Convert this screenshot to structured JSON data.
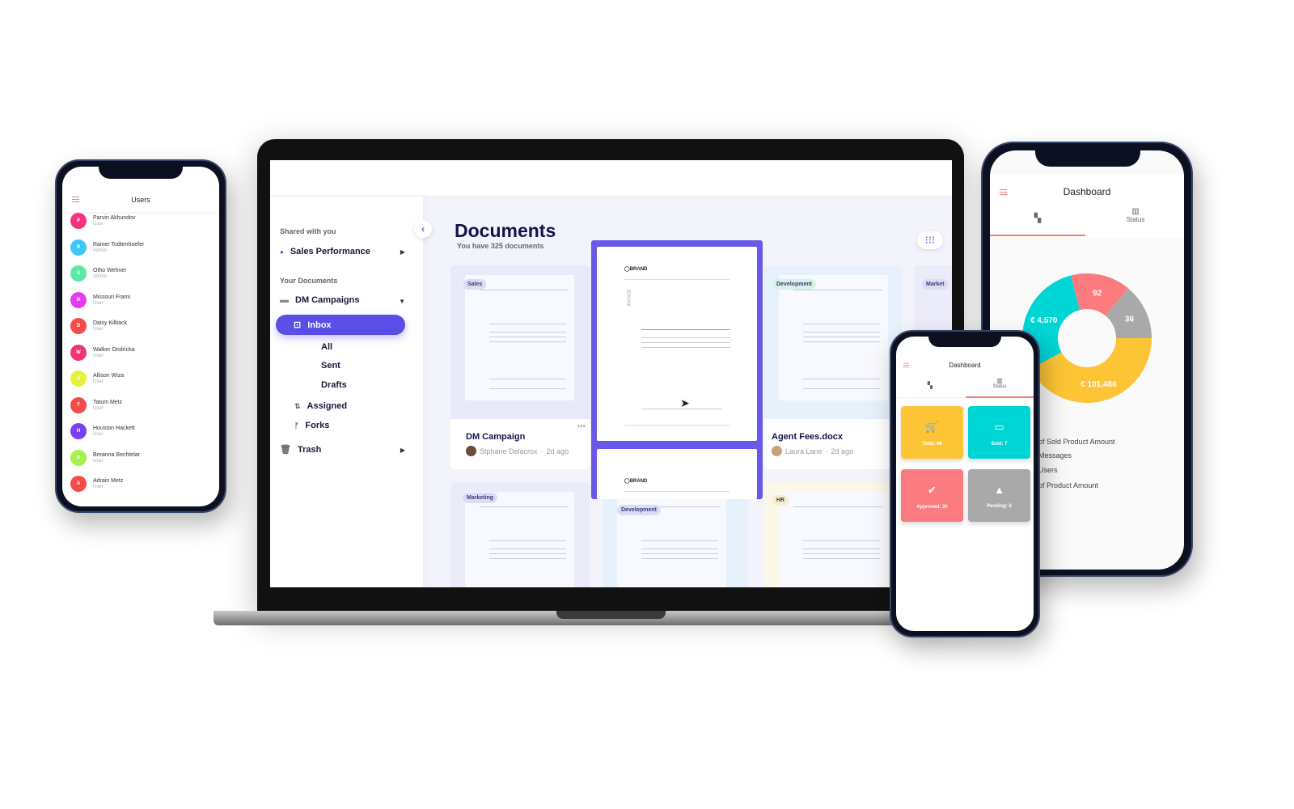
{
  "laptop": {
    "sidebar": {
      "shared_caption": "Shared with you",
      "shared_item": "Sales Performance",
      "your_caption": "Your Documents",
      "folder": "DM Campaigns",
      "inbox": "Inbox",
      "sub_items": [
        "All",
        "Sent",
        "Drafts"
      ],
      "assigned": "Assigned",
      "forks": "Forks",
      "trash": "Trash"
    },
    "main": {
      "title": "Documents",
      "subtitle": "You have 325 documents",
      "cards": [
        {
          "tag": "Sales",
          "name": "DM Campaign",
          "author": "Stphane Delacrox",
          "time": "2d ago"
        },
        {
          "tag": "Development",
          "name": "Agent Fees.docx",
          "author": "Laura Lane",
          "time": "2d ago"
        },
        {
          "tag": "Market"
        },
        {
          "tag": "Marketing"
        },
        {
          "tag": "Development"
        },
        {
          "tag": "HR"
        }
      ],
      "invoice_label": "INVOICE"
    },
    "accent": "#5b4ee6"
  },
  "users_phone": {
    "title": "Users",
    "users": [
      {
        "initial": "P",
        "name": "Parvin Akhundov",
        "role": "User",
        "color": "#f5347f"
      },
      {
        "initial": "R",
        "name": "Rainer Todtenhoefer",
        "role": "Admin",
        "color": "#3ec6f9"
      },
      {
        "initial": "O",
        "name": "Otho Wehner",
        "role": "Admin",
        "color": "#5ee8a6"
      },
      {
        "initial": "M",
        "name": "Missouri Frami",
        "role": "User",
        "color": "#e43df0"
      },
      {
        "initial": "D",
        "name": "Daisy Kilback",
        "role": "User",
        "color": "#f44c4c"
      },
      {
        "initial": "W",
        "name": "Walker Ondricka",
        "role": "User",
        "color": "#f0347a"
      },
      {
        "initial": "A",
        "name": "Allison Wiza",
        "role": "User",
        "color": "#e8f23a"
      },
      {
        "initial": "T",
        "name": "Tatum Metz",
        "role": "User",
        "color": "#f44c4c"
      },
      {
        "initial": "H",
        "name": "Houston Hackett",
        "role": "User",
        "color": "#7b3ff0"
      },
      {
        "initial": "B",
        "name": "Breanna Bechtelar",
        "role": "User",
        "color": "#a8f04a"
      },
      {
        "initial": "A",
        "name": "Adrain Metz",
        "role": "User",
        "color": "#f44c4c"
      }
    ]
  },
  "dashboard_phone": {
    "title": "Dashboard",
    "tabs": [
      {
        "icon": "dashboard-icon",
        "label": ""
      },
      {
        "icon": "bar-chart-icon",
        "label": "Status"
      }
    ],
    "active_tab": 0,
    "donut": [
      {
        "label": "€ 101,486",
        "color": "#fdc536",
        "share": 0.42
      },
      {
        "label": "€ 4,570",
        "color": "#00d5d5",
        "share": 0.29
      },
      {
        "label": "92",
        "color": "#fb7b7f",
        "share": 0.15
      },
      {
        "label": "36",
        "color": "#a9a9a9",
        "share": 0.14
      }
    ],
    "legend": [
      "of Sold Product Amount",
      "Messages",
      "Users",
      "of Product Amount"
    ]
  },
  "small_phone": {
    "title": "Dashboard",
    "tabs": [
      {
        "icon": "dashboard-icon",
        "label": ""
      },
      {
        "icon": "bar-chart-icon",
        "label": "Status"
      }
    ],
    "active_tab": 1,
    "tiles": [
      {
        "label": "Total: 48",
        "icon": "cart-icon",
        "color": "#fdc536"
      },
      {
        "label": "Sold: 7",
        "icon": "devices-icon",
        "color": "#00d5d5"
      },
      {
        "label": "Approved: 30",
        "icon": "check-circle-icon",
        "color": "#fb7b7f"
      },
      {
        "label": "Pending: 6",
        "icon": "warning-icon",
        "color": "#a9a9a9"
      }
    ]
  }
}
